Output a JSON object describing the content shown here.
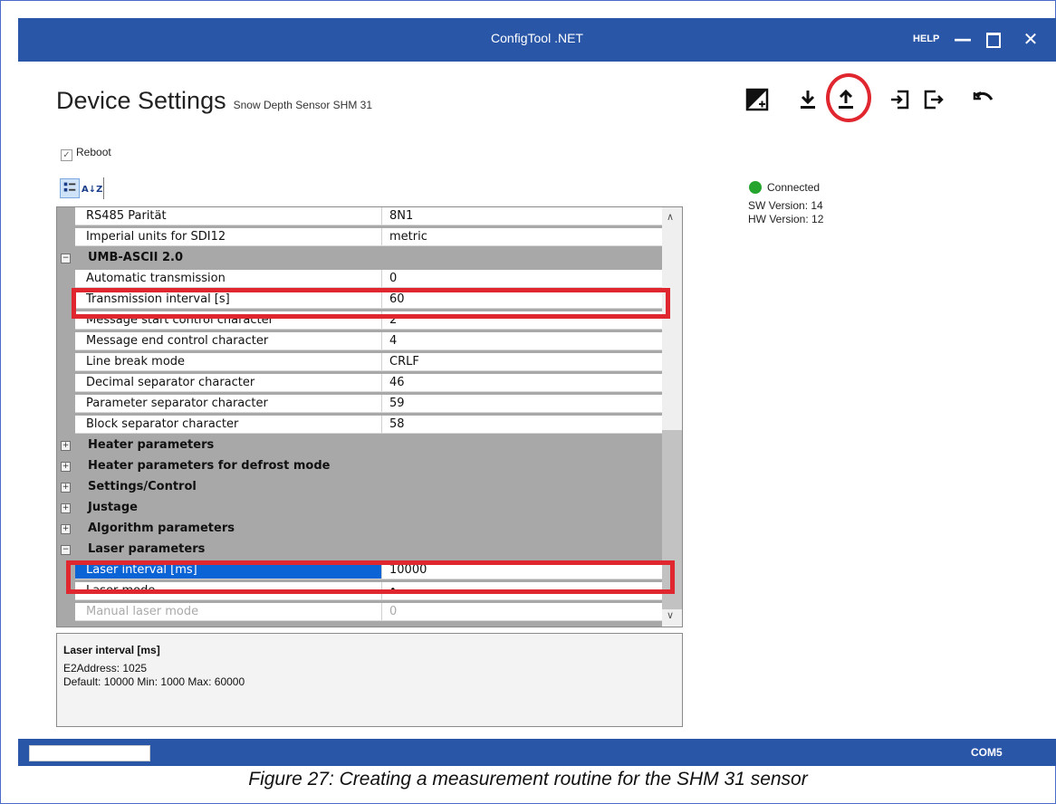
{
  "window": {
    "title": "ConfigTool .NET",
    "help": "HELP",
    "minimize": "—",
    "close": "✕"
  },
  "header": {
    "title": "Device Settings",
    "subtitle": "Snow Depth Sensor SHM 31"
  },
  "toolbar": {
    "icons": [
      "contrast-plus-icon",
      "download-icon",
      "upload-icon",
      "import-icon",
      "export-icon",
      "undo-icon"
    ]
  },
  "reboot": {
    "label": "Reboot",
    "checked": true
  },
  "sortbar": {
    "categorized_icon": "categorized-icon",
    "alphabetical": "A↓Z"
  },
  "grid": {
    "rows": [
      {
        "type": "prop",
        "name": "RS485 Parität",
        "value": "8N1"
      },
      {
        "type": "prop",
        "name": "Imperial units for SDI12",
        "value": "metric"
      },
      {
        "type": "cat",
        "name": "UMB-ASCII 2.0",
        "expanded": true
      },
      {
        "type": "prop",
        "name": "Automatic transmission",
        "value": "0"
      },
      {
        "type": "prop",
        "name": "Transmission interval [s]",
        "value": "60"
      },
      {
        "type": "prop",
        "name": "Message start control character",
        "value": "2"
      },
      {
        "type": "prop",
        "name": "Message end control character",
        "value": "4"
      },
      {
        "type": "prop",
        "name": "Line break mode",
        "value": "CRLF"
      },
      {
        "type": "prop",
        "name": "Decimal separator character",
        "value": "46"
      },
      {
        "type": "prop",
        "name": "Parameter separator character",
        "value": "59"
      },
      {
        "type": "prop",
        "name": "Block separator character",
        "value": "58"
      },
      {
        "type": "cat",
        "name": "Heater parameters",
        "expanded": false
      },
      {
        "type": "cat",
        "name": "Heater parameters for defrost mode",
        "expanded": false
      },
      {
        "type": "cat",
        "name": "Settings/Control",
        "expanded": false
      },
      {
        "type": "cat",
        "name": "Justage",
        "expanded": false
      },
      {
        "type": "cat",
        "name": "Algorithm parameters",
        "expanded": false
      },
      {
        "type": "cat",
        "name": "Laser parameters",
        "expanded": true
      },
      {
        "type": "prop",
        "name": "Laser interval [ms]",
        "value": "10000",
        "selected": true
      },
      {
        "type": "prop",
        "name": "Laser mode",
        "value": "•"
      },
      {
        "type": "prop",
        "name": "Manual laser mode",
        "value": "0",
        "dim": true
      }
    ]
  },
  "description": {
    "title": "Laser interval [ms]",
    "line1": "E2Address: 1025",
    "line2": "Default: 10000 Min: 1000 Max: 60000"
  },
  "status": {
    "connection": "Connected",
    "sw_version": "SW Version: 14",
    "hw_version": "HW Version: 12",
    "indicator_color": "#26a52e"
  },
  "statusbar": {
    "port": "COM5"
  },
  "caption": "Figure 27: Creating a measurement routine for the SHM 31 sensor",
  "colors": {
    "titlebar": "#2a56a8",
    "highlight": "#e0262f",
    "selection": "#0a64d6"
  }
}
